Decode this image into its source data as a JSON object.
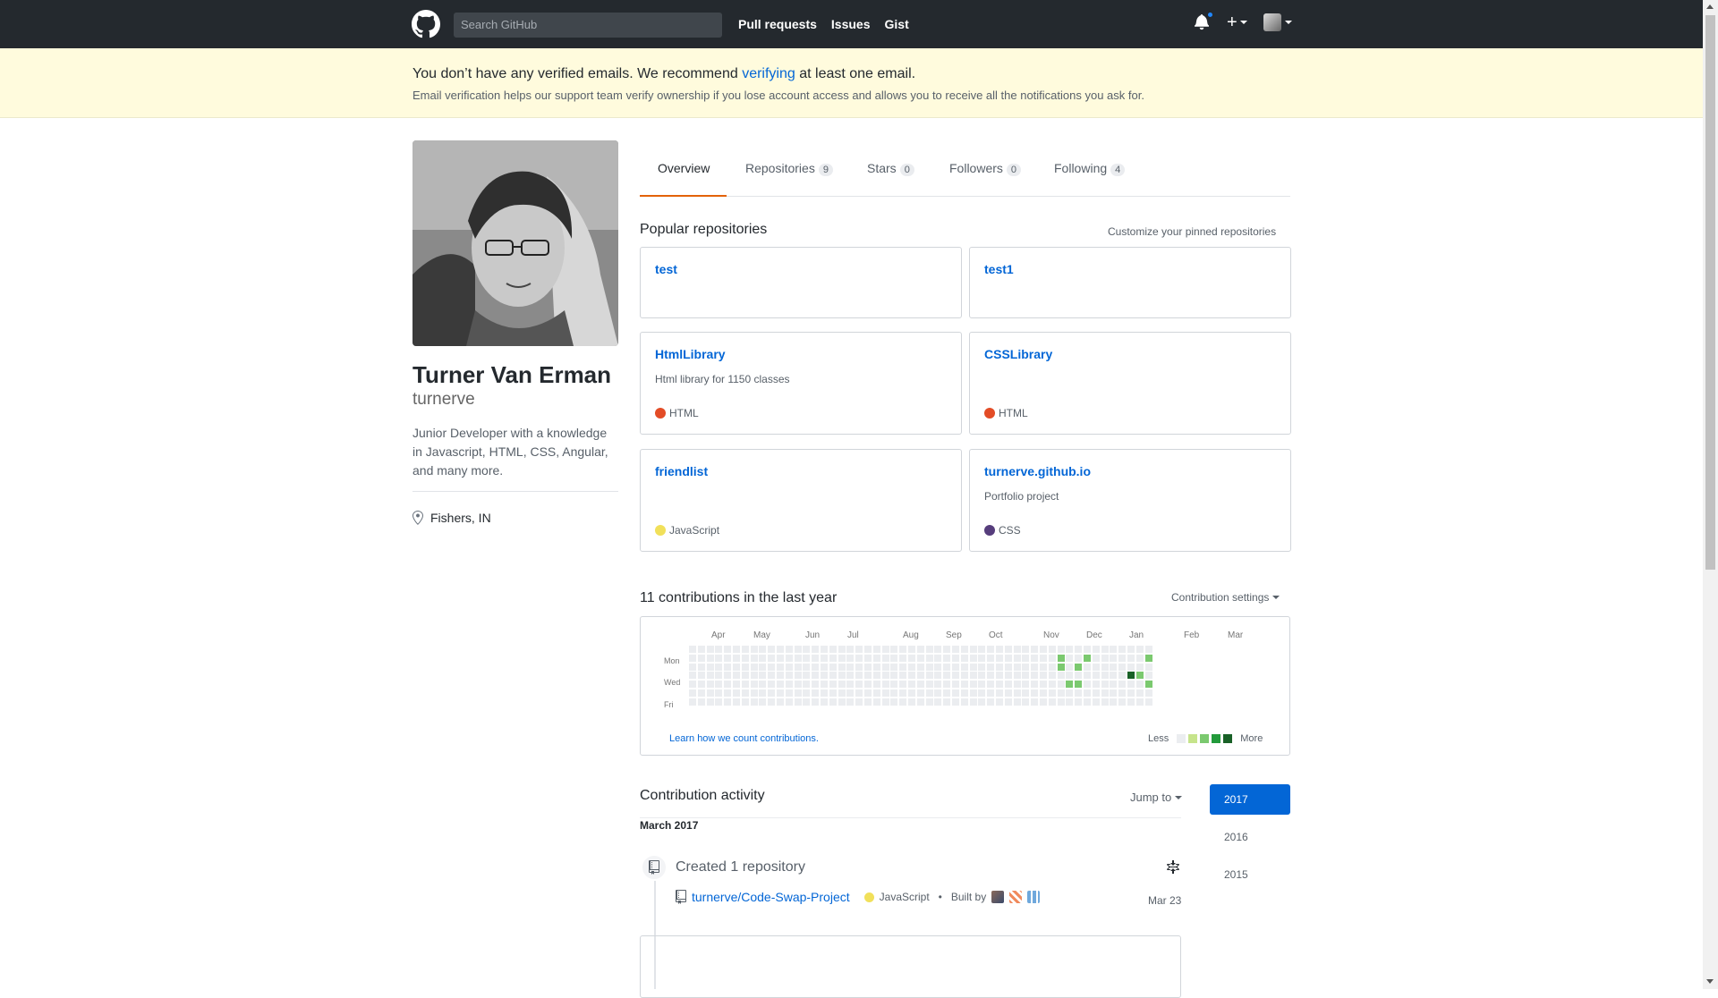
{
  "header": {
    "search_placeholder": "Search GitHub",
    "nav": [
      "Pull requests",
      "Issues",
      "Gist"
    ]
  },
  "banner": {
    "title_before": "You don’t have any verified emails. We recommend ",
    "title_link": "verifying",
    "title_after": " at least one email.",
    "subtitle": "Email verification helps our support team verify ownership if you lose account access and allows you to receive all the notifications you ask for."
  },
  "profile": {
    "name": "Turner Van Erman",
    "username": "turnerve",
    "bio": "Junior Developer with a knowledge in Javascript, HTML, CSS, Angular, and many more.",
    "location": "Fishers, IN"
  },
  "tabs": [
    {
      "label": "Overview",
      "count": ""
    },
    {
      "label": "Repositories",
      "count": "9"
    },
    {
      "label": "Stars",
      "count": "0"
    },
    {
      "label": "Followers",
      "count": "0"
    },
    {
      "label": "Following",
      "count": "4"
    }
  ],
  "popular": {
    "title": "Popular repositories",
    "customize": "Customize your pinned repositories",
    "repos": [
      {
        "name": "test",
        "desc": "",
        "lang": ""
      },
      {
        "name": "test1",
        "desc": "",
        "lang": ""
      },
      {
        "name": "HtmlLibrary",
        "desc": "Html library for 1150 classes",
        "lang": "HTML"
      },
      {
        "name": "CSSLibrary",
        "desc": "",
        "lang": "HTML"
      },
      {
        "name": "friendlist",
        "desc": "",
        "lang": "JavaScript"
      },
      {
        "name": "turnerve.github.io",
        "desc": "Portfolio project",
        "lang": "CSS"
      }
    ]
  },
  "lang_colors": {
    "HTML": "#e34c26",
    "JavaScript": "#f1e05a",
    "CSS": "#563d7c"
  },
  "contributions": {
    "title": "11 contributions in the last year",
    "settings": "Contribution settings",
    "months": [
      "Apr",
      "May",
      "Jun",
      "Jul",
      "Aug",
      "Sep",
      "Oct",
      "Nov",
      "Dec",
      "Jan",
      "Feb",
      "Mar"
    ],
    "days": [
      "Mon",
      "Wed",
      "Fri"
    ],
    "learn": "Learn how we count contributions.",
    "less": "Less",
    "more": "More",
    "levels": [
      "#ebedf0",
      "#c6e48b",
      "#7bc96f",
      "#239a3b",
      "#196127"
    ]
  },
  "activity": {
    "title": "Contribution activity",
    "jump": "Jump to",
    "month": "March 2017",
    "event_title": "Created 1 repository",
    "repo": "turnerve/Code-Swap-Project",
    "lang": "JavaScript",
    "built_by": "Built by",
    "date": "Mar 23",
    "years": [
      "2017",
      "2016",
      "2015"
    ]
  }
}
